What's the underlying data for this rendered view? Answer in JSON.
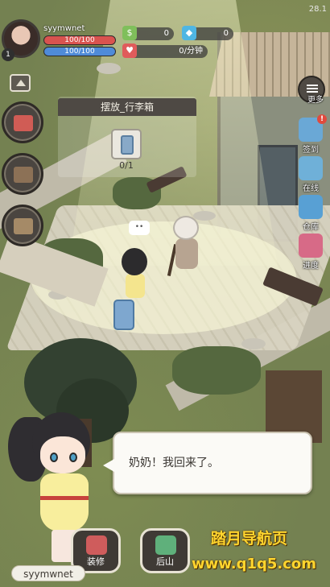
{
  "version": "28.1",
  "player": {
    "name": "syymwnet",
    "level": "1",
    "hp_text": "100/100",
    "mp_text": "100/100",
    "hp_fraction": 1.0,
    "mp_fraction": 1.0
  },
  "resources": {
    "cash": "0",
    "gem": "0",
    "heart_rate": "0/分钟"
  },
  "task": {
    "title": "摆放_行李箱",
    "progress": "0/1",
    "item_icon": "suitcase-icon"
  },
  "right_menu": {
    "more": "更多",
    "checkin": "签到",
    "online": "在线",
    "warehouse": "仓库",
    "progress": "进度"
  },
  "dialog": {
    "text": "奶奶！我回来了。"
  },
  "scene": {
    "npc_bubble": "••"
  },
  "bottom_bar": {
    "name_tag": "syymwnet",
    "renovate": "装修",
    "backhill": "后山"
  },
  "watermark": {
    "line1": "踏月导航页",
    "line2": "www.q1q5.com"
  },
  "colors": {
    "hp": "#d9534f",
    "mp": "#4f8bd9",
    "dialog_bg": "#fbfaf6",
    "watermark": "#ffd52e"
  }
}
